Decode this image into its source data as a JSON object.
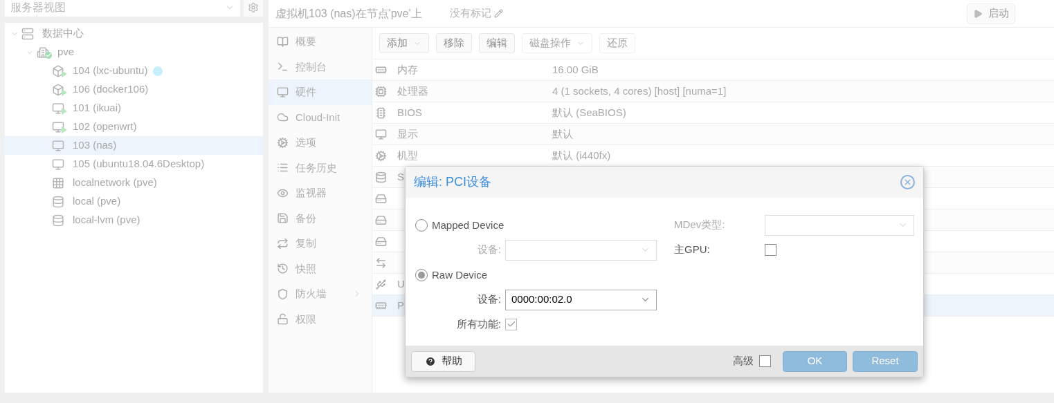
{
  "view_selector": {
    "value": "服务器视图"
  },
  "tree": [
    {
      "label": "数据中心",
      "kind": "datacenter",
      "expanded": true,
      "selected": false,
      "children": [
        {
          "label": "pve",
          "kind": "node",
          "expanded": true,
          "selected": false,
          "children": [
            {
              "label": "104 (lxc-ubuntu)",
              "kind": "ct",
              "running": true,
              "selected": false,
              "color": "#c6eefb"
            },
            {
              "label": "106 (docker106)",
              "kind": "ct",
              "running": true,
              "selected": false
            },
            {
              "label": "101 (ikuai)",
              "kind": "vm",
              "running": true,
              "selected": false
            },
            {
              "label": "102 (openwrt)",
              "kind": "vm",
              "running": true,
              "selected": false
            },
            {
              "label": "103 (nas)",
              "kind": "vm",
              "running": false,
              "selected": true
            },
            {
              "label": "105 (ubuntu18.04.6Desktop)",
              "kind": "vm",
              "running": false,
              "selected": false
            },
            {
              "label": "localnetwork (pve)",
              "kind": "sdn",
              "selected": false
            },
            {
              "label": "local (pve)",
              "kind": "storage",
              "selected": false
            },
            {
              "label": "local-lvm (pve)",
              "kind": "storage",
              "selected": false
            }
          ]
        }
      ]
    }
  ],
  "header": {
    "title": "虚拟机103 (nas)在节点'pve'上",
    "tags": "没有标记",
    "start_button": "启动"
  },
  "nav": [
    {
      "label": "概要",
      "selected": false
    },
    {
      "label": "控制台",
      "selected": false
    },
    {
      "label": "硬件",
      "selected": true
    },
    {
      "label": "Cloud-Init",
      "selected": false
    },
    {
      "label": "选项",
      "selected": false
    },
    {
      "label": "任务历史",
      "selected": false
    },
    {
      "label": "监视器",
      "selected": false
    },
    {
      "label": "备份",
      "selected": false
    },
    {
      "label": "复制",
      "selected": false
    },
    {
      "label": "快照",
      "selected": false
    },
    {
      "label": "防火墙",
      "selected": false,
      "submenu": true
    },
    {
      "label": "权限",
      "selected": false
    }
  ],
  "toolbar": [
    {
      "label": "添加",
      "dropdown": true,
      "disabled": false
    },
    {
      "label": "移除",
      "dropdown": false,
      "disabled": false
    },
    {
      "label": "编辑",
      "dropdown": false,
      "disabled": false
    },
    {
      "label": "磁盘操作",
      "dropdown": true,
      "disabled": true
    },
    {
      "label": "还原",
      "dropdown": false,
      "disabled": true
    }
  ],
  "hardware": [
    {
      "kind": "memory",
      "name": "内存",
      "value": "16.00 GiB",
      "selected": false
    },
    {
      "kind": "cpu",
      "name": "处理器",
      "value": "4 (1 sockets, 4 cores) [host] [numa=1]",
      "selected": false
    },
    {
      "kind": "bios",
      "name": "BIOS",
      "value": "默认 (SeaBIOS)",
      "selected": false
    },
    {
      "kind": "display",
      "name": "显示",
      "value": "默认",
      "selected": false
    },
    {
      "kind": "machine",
      "name": "机型",
      "value": "默认 (i440fx)",
      "selected": false
    },
    {
      "kind": "scsi",
      "name": "S",
      "selected": false
    },
    {
      "kind": "disk",
      "selected": false
    },
    {
      "kind": "disk",
      "selected": false
    },
    {
      "kind": "disk",
      "selected": false
    },
    {
      "kind": "network",
      "selected": false
    },
    {
      "kind": "usb",
      "name": "U",
      "selected": false
    },
    {
      "kind": "pci",
      "name": "P",
      "selected": true
    }
  ],
  "dialog": {
    "title": "编辑: PCI设备",
    "mapped": {
      "label": "Mapped Device",
      "selected": false,
      "device_label": "设备:"
    },
    "raw": {
      "label": "Raw Device",
      "selected": true,
      "device_label": "设备:",
      "device_value": "0000:00:02.0",
      "all_functions_label": "所有功能:",
      "all_functions": true
    },
    "mdev_label": "MDev类型:",
    "primary_gpu_label": "主GPU:",
    "primary_gpu": false,
    "help_button": "帮助",
    "advanced_label": "高级",
    "advanced": false,
    "ok_button": "OK",
    "reset_button": "Reset"
  }
}
